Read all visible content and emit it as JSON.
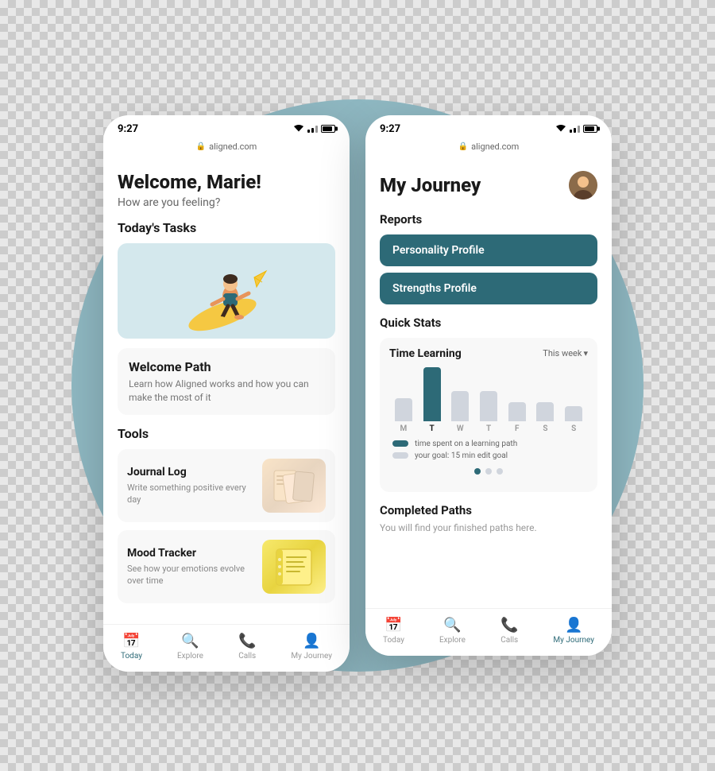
{
  "scene": {
    "background": "#8fb8c2"
  },
  "left_phone": {
    "status_bar": {
      "time": "9:27",
      "url": "aligned.com"
    },
    "welcome": {
      "title": "Welcome, Marie!",
      "subtitle": "How are you feeling?"
    },
    "tasks_section": {
      "label": "Today's Tasks"
    },
    "path_card": {
      "title": "Welcome Path",
      "description": "Learn how Aligned works and how you can make the most of it"
    },
    "tools_section": {
      "label": "Tools"
    },
    "tool_journal": {
      "title": "Journal Log",
      "description": "Write something positive every day"
    },
    "tool_mood": {
      "title": "Mood Tracker",
      "description": "See how your emotions evolve over time"
    },
    "nav": {
      "today": "Today",
      "explore": "Explore",
      "calls": "Calls",
      "my_journey": "My Journey"
    }
  },
  "right_phone": {
    "status_bar": {
      "time": "9:27",
      "url": "aligned.com"
    },
    "header": {
      "title": "My Journey"
    },
    "reports": {
      "label": "Reports",
      "personality_profile": "Personality Profile",
      "strengths_profile": "Strengths Profile"
    },
    "quick_stats": {
      "label": "Quick Stats"
    },
    "time_learning": {
      "label": "Time Learning",
      "period": "This week"
    },
    "chart": {
      "days": [
        "M",
        "T",
        "W",
        "T",
        "F",
        "S",
        "S"
      ],
      "active_day": 1,
      "bars": [
        30,
        72,
        40,
        40,
        25,
        25,
        20
      ]
    },
    "legend": {
      "item1": "time spent on a learning path",
      "item2": "your goal: 15 min edit goal"
    },
    "completed_paths": {
      "title": "Completed Paths",
      "description": "You will find your finished paths here."
    },
    "nav": {
      "today": "Today",
      "explore": "Explore",
      "calls": "Calls",
      "my_journey": "My Journey"
    }
  }
}
